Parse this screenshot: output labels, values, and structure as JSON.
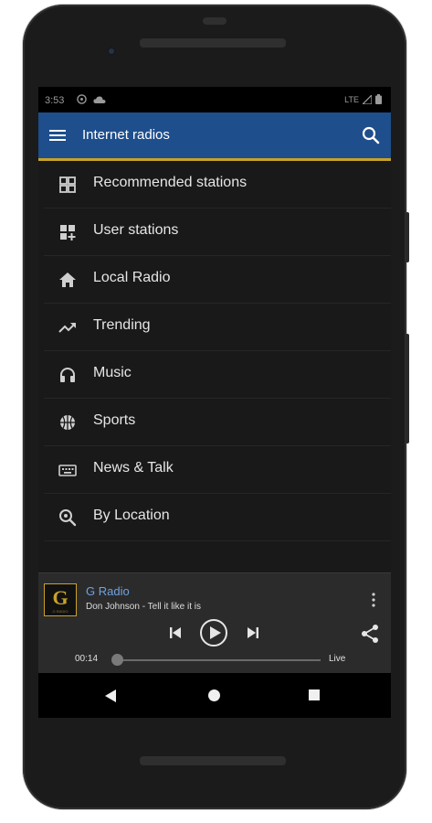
{
  "status_bar": {
    "time": "3:53",
    "network": "LTE"
  },
  "app_bar": {
    "title": "Internet radios"
  },
  "menu": {
    "items": [
      {
        "label": "Recommended stations",
        "icon": "grid-icon"
      },
      {
        "label": "User stations",
        "icon": "grid-add-icon"
      },
      {
        "label": "Local Radio",
        "icon": "home-icon"
      },
      {
        "label": "Trending",
        "icon": "trending-icon"
      },
      {
        "label": "Music",
        "icon": "headphones-icon"
      },
      {
        "label": "Sports",
        "icon": "basketball-icon"
      },
      {
        "label": "News & Talk",
        "icon": "keyboard-icon"
      },
      {
        "label": "By Location",
        "icon": "search-location-icon"
      }
    ]
  },
  "player": {
    "logo_letter": "G",
    "logo_text": "G RADIO",
    "station": "G Radio",
    "track": "Don Johnson - Tell it like it is",
    "elapsed": "00:14",
    "live_label": "Live",
    "progress": 0
  },
  "colors": {
    "app_bar": "#1e4e8c",
    "accent": "#c9a227",
    "station_name": "#6fa3e0"
  }
}
